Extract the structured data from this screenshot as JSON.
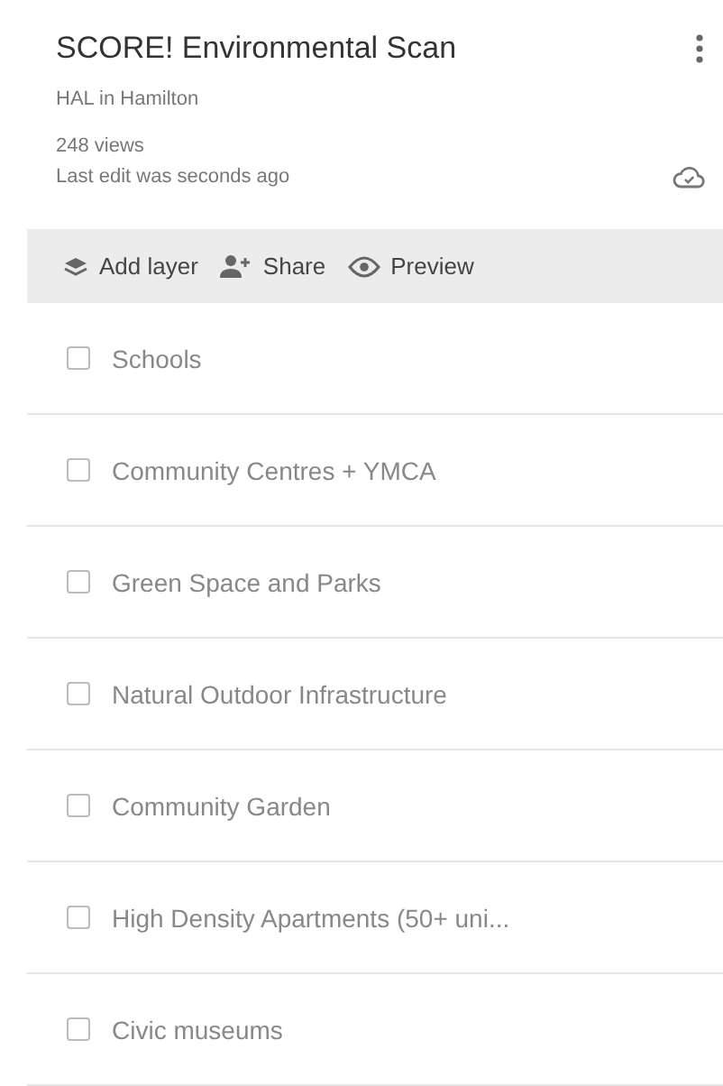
{
  "header": {
    "title": "SCORE! Environmental Scan",
    "owner": "HAL in Hamilton",
    "views": "248 views",
    "last_edit": "Last edit was seconds ago"
  },
  "toolbar": [
    {
      "kind": "layers",
      "label": "Add layer"
    },
    {
      "kind": "share",
      "label": "Share"
    },
    {
      "kind": "preview",
      "label": "Preview"
    }
  ],
  "layers": [
    {
      "label": "Schools",
      "checked": false
    },
    {
      "label": "Community Centres + YMCA",
      "checked": false
    },
    {
      "label": "Green Space and Parks",
      "checked": false
    },
    {
      "label": "Natural Outdoor Infrastructure",
      "checked": false
    },
    {
      "label": "Community Garden",
      "checked": false
    },
    {
      "label": "High Density Apartments (50+ uni...",
      "checked": false
    },
    {
      "label": "Civic museums",
      "checked": false
    }
  ]
}
